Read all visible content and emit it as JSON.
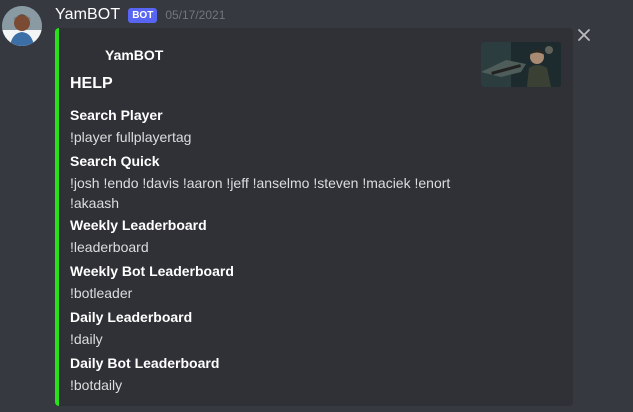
{
  "message": {
    "username": "YamBOT",
    "badge": "BOT",
    "timestamp": "05/17/2021"
  },
  "embed": {
    "accent_color": "#28e01b",
    "author": "YamBOT",
    "title": "HELP",
    "fields": [
      {
        "name": "Search Player",
        "value": "!player fullplayertag"
      },
      {
        "name": "Search Quick",
        "value": "!josh !endo !davis !aaron !jeff !anselmo !steven !maciek !enort !akaash"
      },
      {
        "name": "Weekly Leaderboard",
        "value": "!leaderboard"
      },
      {
        "name": "Weekly Bot Leaderboard",
        "value": "!botleader"
      },
      {
        "name": "Daily Leaderboard",
        "value": "!daily"
      },
      {
        "name": "Daily Bot Leaderboard",
        "value": "!botdaily"
      }
    ]
  },
  "colors": {
    "background": "#36393f",
    "embed_background": "#2f3136",
    "badge": "#5865f2"
  },
  "icons": {
    "close": "close-icon"
  }
}
